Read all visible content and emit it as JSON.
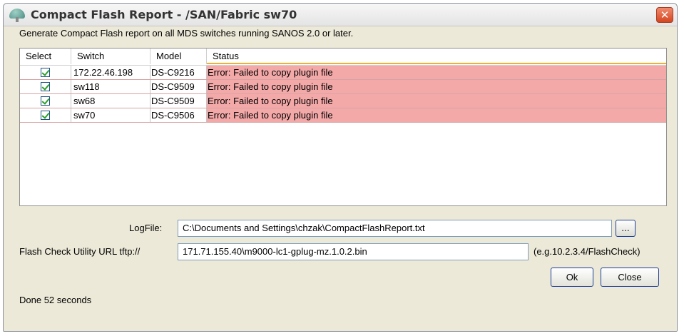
{
  "window": {
    "title": "Compact Flash Report - /SAN/Fabric sw70",
    "close_label": "✕"
  },
  "description": "Generate Compact Flash report on all MDS switches running SANOS 2.0 or later.",
  "table": {
    "headers": [
      "Select",
      "Switch",
      "Model",
      "Status"
    ],
    "rows": [
      {
        "selected": true,
        "switch": "172.22.46.198",
        "model": "DS-C9216",
        "status": "Error: Failed to copy plugin file"
      },
      {
        "selected": true,
        "switch": "sw118",
        "model": "DS-C9509",
        "status": "Error: Failed to copy plugin file"
      },
      {
        "selected": true,
        "switch": "sw68",
        "model": "DS-C9509",
        "status": "Error: Failed to copy plugin file"
      },
      {
        "selected": true,
        "switch": "sw70",
        "model": "DS-C9506",
        "status": "Error: Failed to copy plugin file"
      }
    ]
  },
  "logfile": {
    "label": "LogFile:",
    "value": "C:\\Documents and Settings\\chzak\\CompactFlashReport.txt",
    "browse_label": "..."
  },
  "url": {
    "label": "Flash Check Utility URL tftp://",
    "value": "171.71.155.40\\m9000-lc1-gplug-mz.1.0.2.bin",
    "hint": "(e.g.10.2.3.4/FlashCheck)"
  },
  "buttons": {
    "ok": "Ok",
    "close": "Close"
  },
  "status": "Done 52 seconds",
  "colors": {
    "error_row": "#f4a9a9",
    "dialog_bg": "#ece9d8",
    "close_button": "#d4451f"
  }
}
